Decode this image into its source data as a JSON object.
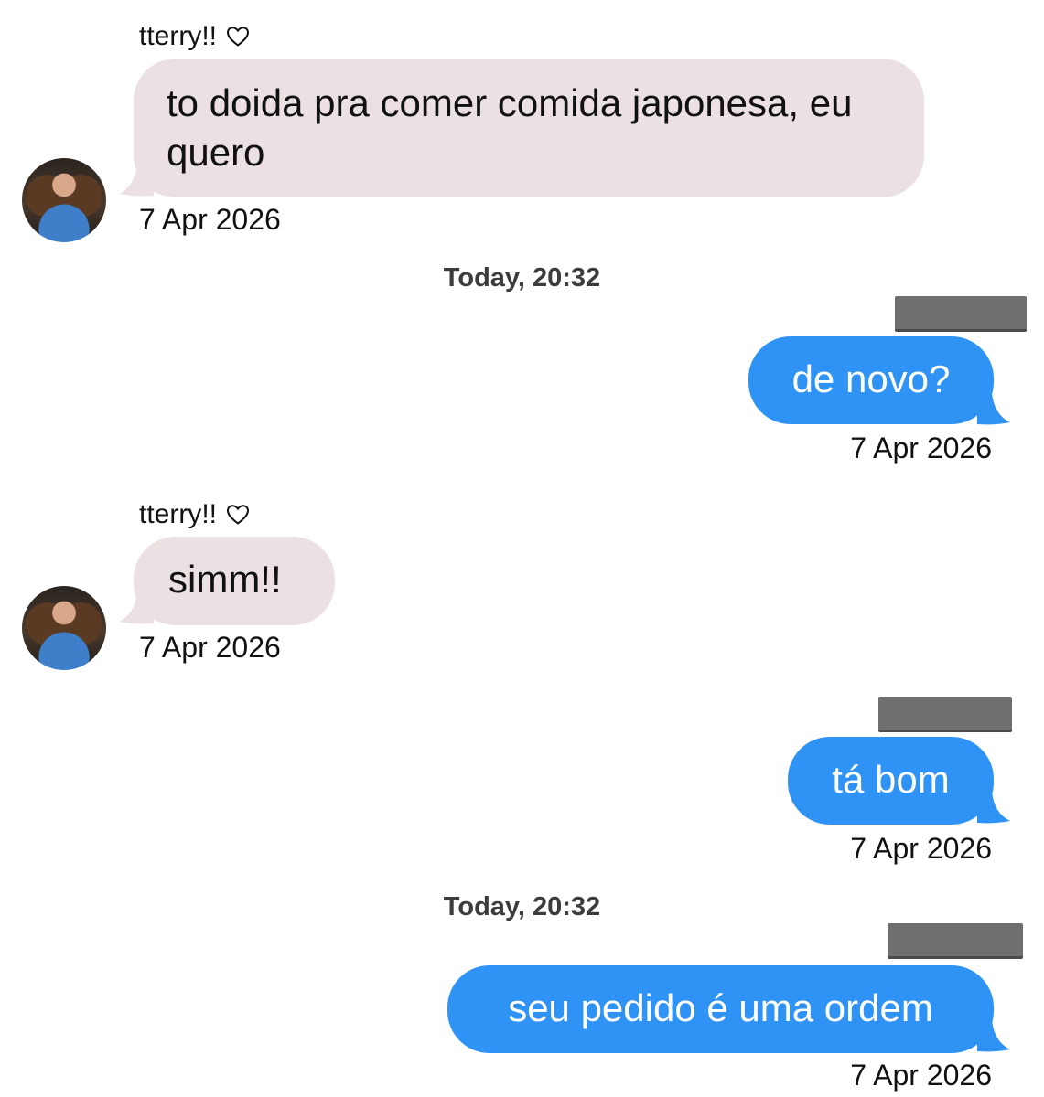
{
  "messages": [
    {
      "sender": "tterry!!",
      "text": "to doida pra comer comida japonesa, eu quero",
      "date": "7 Apr 2026"
    },
    {
      "text": "de novo?",
      "date": "7 Apr 2026"
    },
    {
      "sender": "tterry!!",
      "text": "simm!!",
      "date": "7 Apr 2026"
    },
    {
      "text": "tá bom",
      "date": "7 Apr 2026"
    },
    {
      "text": "seu pedido é uma ordem",
      "date": "7 Apr 2026"
    }
  ],
  "separators": [
    "Today, 20:32",
    "Today, 20:32"
  ],
  "icons": {
    "heart": "heart-outline-icon"
  },
  "colors": {
    "incoming_bubble": "#ebe1e2",
    "outgoing_bubble": "#2f93f5",
    "redaction": "#6f6f72"
  }
}
